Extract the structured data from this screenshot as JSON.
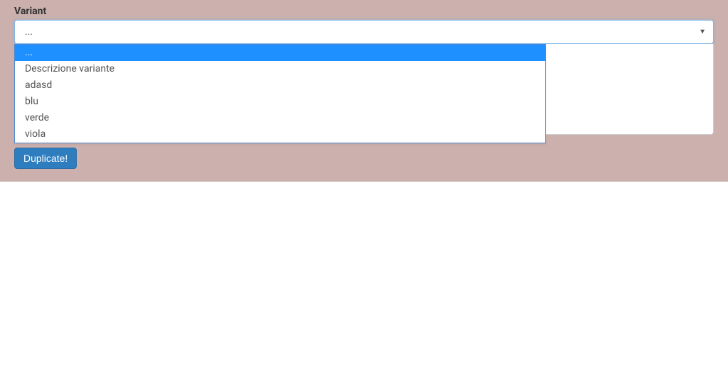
{
  "form": {
    "variant_label": "Variant",
    "selected_value": "...",
    "options": [
      {
        "label": "...",
        "highlighted": true
      },
      {
        "label": "Descrizione variante",
        "highlighted": false
      },
      {
        "label": "adasd",
        "highlighted": false
      },
      {
        "label": "blu",
        "highlighted": false
      },
      {
        "label": "verde",
        "highlighted": false
      },
      {
        "label": "viola",
        "highlighted": false
      }
    ]
  },
  "actions": {
    "duplicate_label": "Duplicate!"
  }
}
